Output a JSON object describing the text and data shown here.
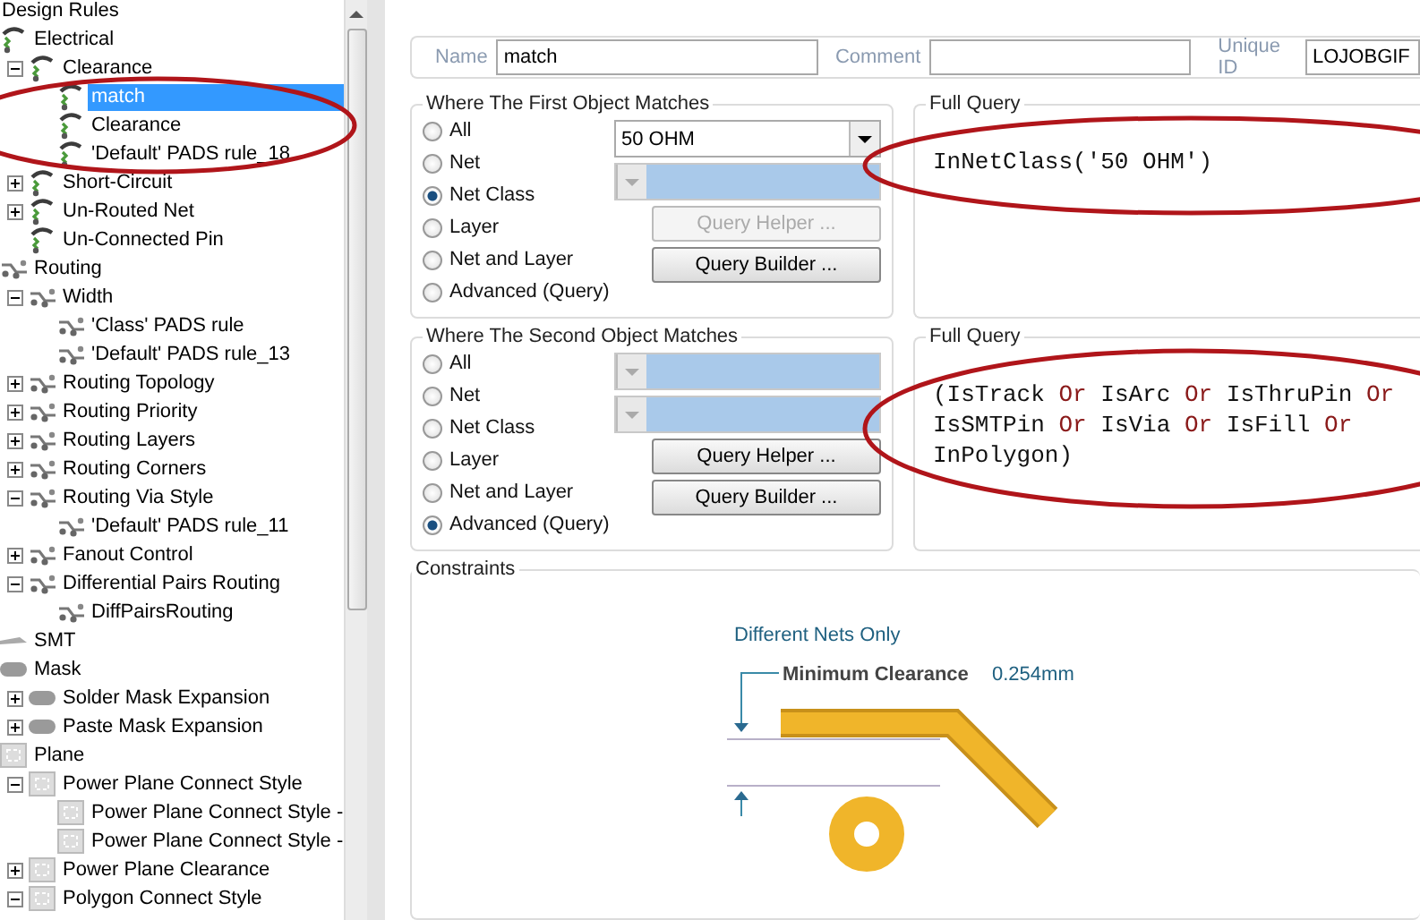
{
  "tree": {
    "title": "Design Rules",
    "items": [
      {
        "label": "Electrical",
        "kind": "electrical",
        "children": [
          {
            "label": "Clearance",
            "expanded": true,
            "circled": true,
            "children": [
              {
                "label": "match",
                "selected": true
              },
              {
                "label": "Clearance",
                "selected": false
              },
              {
                "label": "'Default' PADS rule_18",
                "selected": false
              }
            ]
          },
          {
            "label": "Short-Circuit",
            "expanded": false
          },
          {
            "label": "Un-Routed Net",
            "expanded": false
          },
          {
            "label": "Un-Connected Pin"
          }
        ]
      },
      {
        "label": "Routing",
        "kind": "routing",
        "children": [
          {
            "label": "Width",
            "expanded": true,
            "children": [
              {
                "label": "'Class' PADS rule",
                "selected": false
              },
              {
                "label": "'Default' PADS rule_13",
                "selected": false
              }
            ]
          },
          {
            "label": "Routing Topology",
            "expanded": false
          },
          {
            "label": "Routing Priority",
            "expanded": false
          },
          {
            "label": "Routing Layers",
            "expanded": false
          },
          {
            "label": "Routing Corners",
            "expanded": false
          },
          {
            "label": "Routing Via Style",
            "expanded": true,
            "children": [
              {
                "label": "'Default' PADS rule_11",
                "selected": false
              }
            ]
          },
          {
            "label": "Fanout Control",
            "expanded": false
          },
          {
            "label": "Differential Pairs Routing",
            "expanded": true,
            "children": [
              {
                "label": "DiffPairsRouting",
                "selected": false
              }
            ]
          }
        ]
      },
      {
        "label": "SMT",
        "kind": "smt"
      },
      {
        "label": "Mask",
        "kind": "mask",
        "children": [
          {
            "label": "Solder Mask Expansion",
            "expanded": false
          },
          {
            "label": "Paste Mask Expansion",
            "expanded": false
          }
        ]
      },
      {
        "label": "Plane",
        "kind": "plane",
        "children": [
          {
            "label": "Power Plane Connect Style",
            "expanded": true,
            "children": [
              {
                "label": "Power Plane Connect Style -",
                "selected": false
              },
              {
                "label": "Power Plane Connect Style -",
                "selected": false
              }
            ]
          },
          {
            "label": "Power Plane Clearance",
            "expanded": false
          },
          {
            "label": "Polygon Connect Style",
            "expanded": true
          }
        ]
      }
    ]
  },
  "rule": {
    "name_label": "Name",
    "name": "match",
    "comment_label": "Comment",
    "unique_id_label": "Unique ID",
    "unique_id": "LOJOBGIF"
  },
  "scopes": [
    {
      "title": "Where The First Object Matches",
      "options": [
        {
          "label": "All",
          "selected": false
        },
        {
          "label": "Net",
          "selected": false
        },
        {
          "label": "Net Class",
          "selected": true
        },
        {
          "label": "Layer",
          "selected": false
        },
        {
          "label": "Net and Layer",
          "selected": false
        },
        {
          "label": "Advanced (Query)",
          "selected": false
        }
      ],
      "dropdowns": [
        {
          "value": "50 OHM",
          "disabled": false
        },
        {
          "disabled": true
        }
      ],
      "buttons": [
        {
          "label": "Query Helper ...",
          "disabled": true
        },
        {
          "label": "Query Builder ...",
          "disabled": false
        }
      ],
      "query_title": "Full Query",
      "circled": true,
      "query": [
        {
          "text": "InNetClass('50 OHM')",
          "kind": "term"
        }
      ]
    },
    {
      "title": "Where The Second Object Matches",
      "options": [
        {
          "label": "All",
          "selected": false
        },
        {
          "label": "Net",
          "selected": false
        },
        {
          "label": "Net Class",
          "selected": false
        },
        {
          "label": "Layer",
          "selected": false
        },
        {
          "label": "Net and Layer",
          "selected": false
        },
        {
          "label": "Advanced (Query)",
          "selected": true
        }
      ],
      "dropdowns": [
        {
          "disabled": true
        },
        {
          "disabled": true
        }
      ],
      "buttons": [
        {
          "label": "Query Helper ...",
          "disabled": false
        },
        {
          "label": "Query Builder ...",
          "disabled": false
        }
      ],
      "query_title": "Full Query",
      "circled": true,
      "query": [
        {
          "text": "(IsTrack",
          "kind": "term"
        },
        {
          "text": "Or",
          "kind": "operator"
        },
        {
          "text": "IsArc",
          "kind": "term"
        },
        {
          "text": "Or",
          "kind": "operator"
        },
        {
          "text": "IsThruPin",
          "kind": "term"
        },
        {
          "text": "Or",
          "kind": "operator"
        },
        {
          "text": "IsSMTPin",
          "kind": "term"
        },
        {
          "text": "Or",
          "kind": "operator"
        },
        {
          "text": "IsVia",
          "kind": "term"
        },
        {
          "text": "Or",
          "kind": "operator"
        },
        {
          "text": "IsFill",
          "kind": "term"
        },
        {
          "text": "Or",
          "kind": "operator"
        },
        {
          "text": "InPolygon)",
          "kind": "term"
        }
      ]
    }
  ],
  "constraints": {
    "title": "Constraints",
    "mode": "Different Nets Only",
    "label": "Minimum Clearance",
    "value": "0.254mm"
  }
}
